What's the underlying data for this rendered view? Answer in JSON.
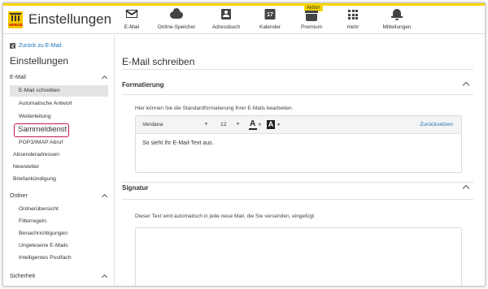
{
  "header": {
    "logo_text": "WEB.DE",
    "title": "Einstellungen",
    "nav": [
      {
        "label": "E-Mail",
        "icon": "mail-icon"
      },
      {
        "label": "Online-Speicher",
        "icon": "cloud-icon"
      },
      {
        "label": "Adressbuch",
        "icon": "contact-icon"
      },
      {
        "label": "Kalender",
        "icon": "calendar-icon",
        "icon_text": "17"
      },
      {
        "label": "Premium",
        "icon": "premium-icon",
        "badge": "Aktion"
      },
      {
        "label": "mehr",
        "icon": "grid-icon"
      },
      {
        "label": "Mitteilungen",
        "icon": "bell-icon"
      }
    ],
    "accent_color": "#f5d400"
  },
  "sidebar": {
    "back_label": "Zurück zu E-Mail",
    "title": "Einstellungen",
    "groups": [
      {
        "label": "E-Mail",
        "items": [
          "E-Mail schreiben",
          "Automatische Antwort",
          "Weiterleitung",
          "Sammeldienst",
          "POP3/IMAP Abruf",
          "Absenderadressen",
          "Newsletter",
          "Briefankündigung"
        ]
      },
      {
        "label": "Ordner",
        "items": [
          "Ordnerübersicht",
          "Filterregeln",
          "Benachrichtigungen",
          "Ungelesene E-Mails",
          "Intelligentes Postfach"
        ]
      },
      {
        "label": "Sicherheit",
        "items": []
      }
    ],
    "active_item": "E-Mail schreiben",
    "highlighted_item": "Sammeldienst",
    "highlight_color": "#c2185b"
  },
  "main": {
    "title": "E-Mail schreiben",
    "formatting": {
      "heading": "Formatierung",
      "hint": "Hier können Sie die Standardformatierung Ihrer E-Mails bearbeiten.",
      "font": "Verdana",
      "size": "12",
      "reset_label": "Zurücksetzen",
      "sample_text": "So sieht Ihr E-Mail-Text aus."
    },
    "signature": {
      "heading": "Signatur",
      "hint": "Dieser Text wird automatisch in jede neue Mail, die Sie versenden, eingefügt."
    }
  }
}
